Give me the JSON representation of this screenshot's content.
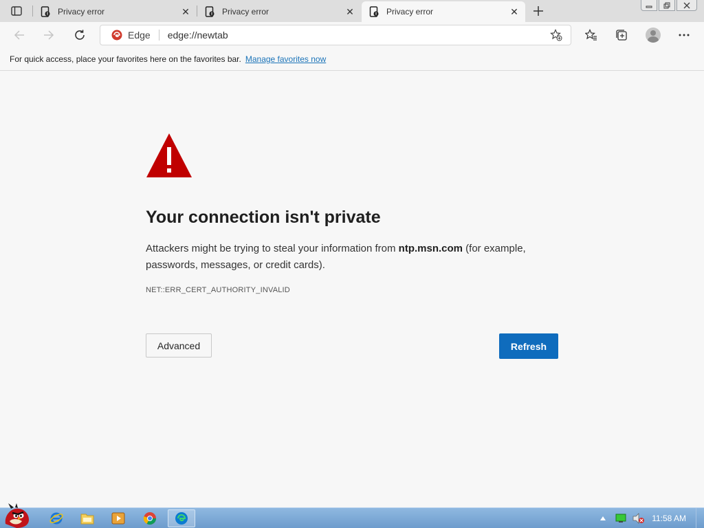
{
  "tabs": [
    {
      "title": "Privacy error"
    },
    {
      "title": "Privacy error"
    },
    {
      "title": "Privacy error"
    }
  ],
  "toolbar": {
    "edge_label": "Edge",
    "url": "edge://newtab"
  },
  "favbar": {
    "message": "For quick access, place your favorites here on the favorites bar.",
    "link": "Manage favorites now"
  },
  "error_page": {
    "heading": "Your connection isn't private",
    "desc_before": "Attackers might be trying to steal your information from ",
    "host": "ntp.msn.com",
    "desc_after": " (for example, passwords, messages, or credit cards).",
    "error_code": "NET::ERR_CERT_AUTHORITY_INVALID",
    "advanced_label": "Advanced",
    "refresh_label": "Refresh"
  },
  "taskbar": {
    "time": "11:58 AM"
  },
  "colors": {
    "accent": "#0f6cbd",
    "warning": "#c00000",
    "edge_red": "#d03b2e"
  }
}
